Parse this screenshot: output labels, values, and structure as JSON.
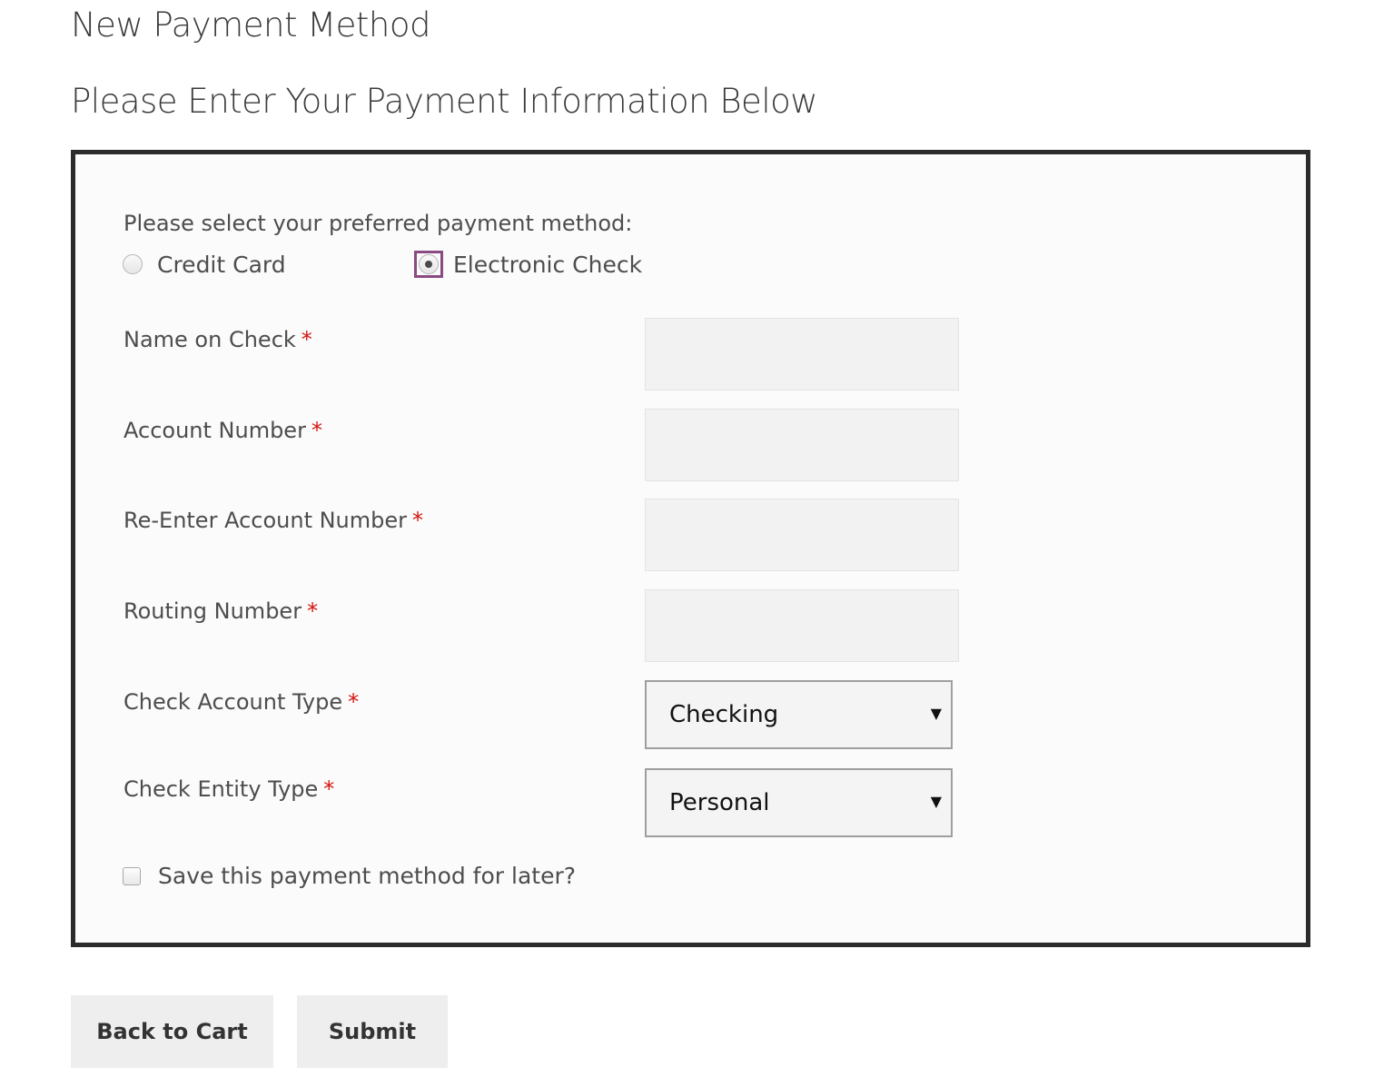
{
  "header": {
    "title": "New Payment Method",
    "subtitle": "Please Enter Your Payment Information Below"
  },
  "payment_method": {
    "prompt": "Please select your preferred payment method:",
    "options": [
      {
        "label": "Credit Card",
        "selected": false
      },
      {
        "label": "Electronic Check",
        "selected": true
      }
    ]
  },
  "fields": {
    "name_on_check": {
      "label": "Name on Check",
      "required_mark": "*",
      "value": ""
    },
    "account_number": {
      "label": "Account Number",
      "required_mark": "*",
      "value": ""
    },
    "reenter_account_number": {
      "label": "Re-Enter Account Number",
      "required_mark": "*",
      "value": ""
    },
    "routing_number": {
      "label": "Routing Number",
      "required_mark": "*",
      "value": ""
    },
    "check_account_type": {
      "label": "Check Account Type",
      "required_mark": "*",
      "value": "Checking",
      "arrow": "▼"
    },
    "check_entity_type": {
      "label": "Check Entity Type",
      "required_mark": "*",
      "value": "Personal",
      "arrow": "▼"
    }
  },
  "save_option": {
    "label": "Save this payment method for later?",
    "checked": false
  },
  "buttons": {
    "back": "Back to Cart",
    "submit": "Submit"
  },
  "colors": {
    "required": "#d4140f",
    "focus_outline": "#8a4a82",
    "box_border": "#2b2b2b"
  }
}
